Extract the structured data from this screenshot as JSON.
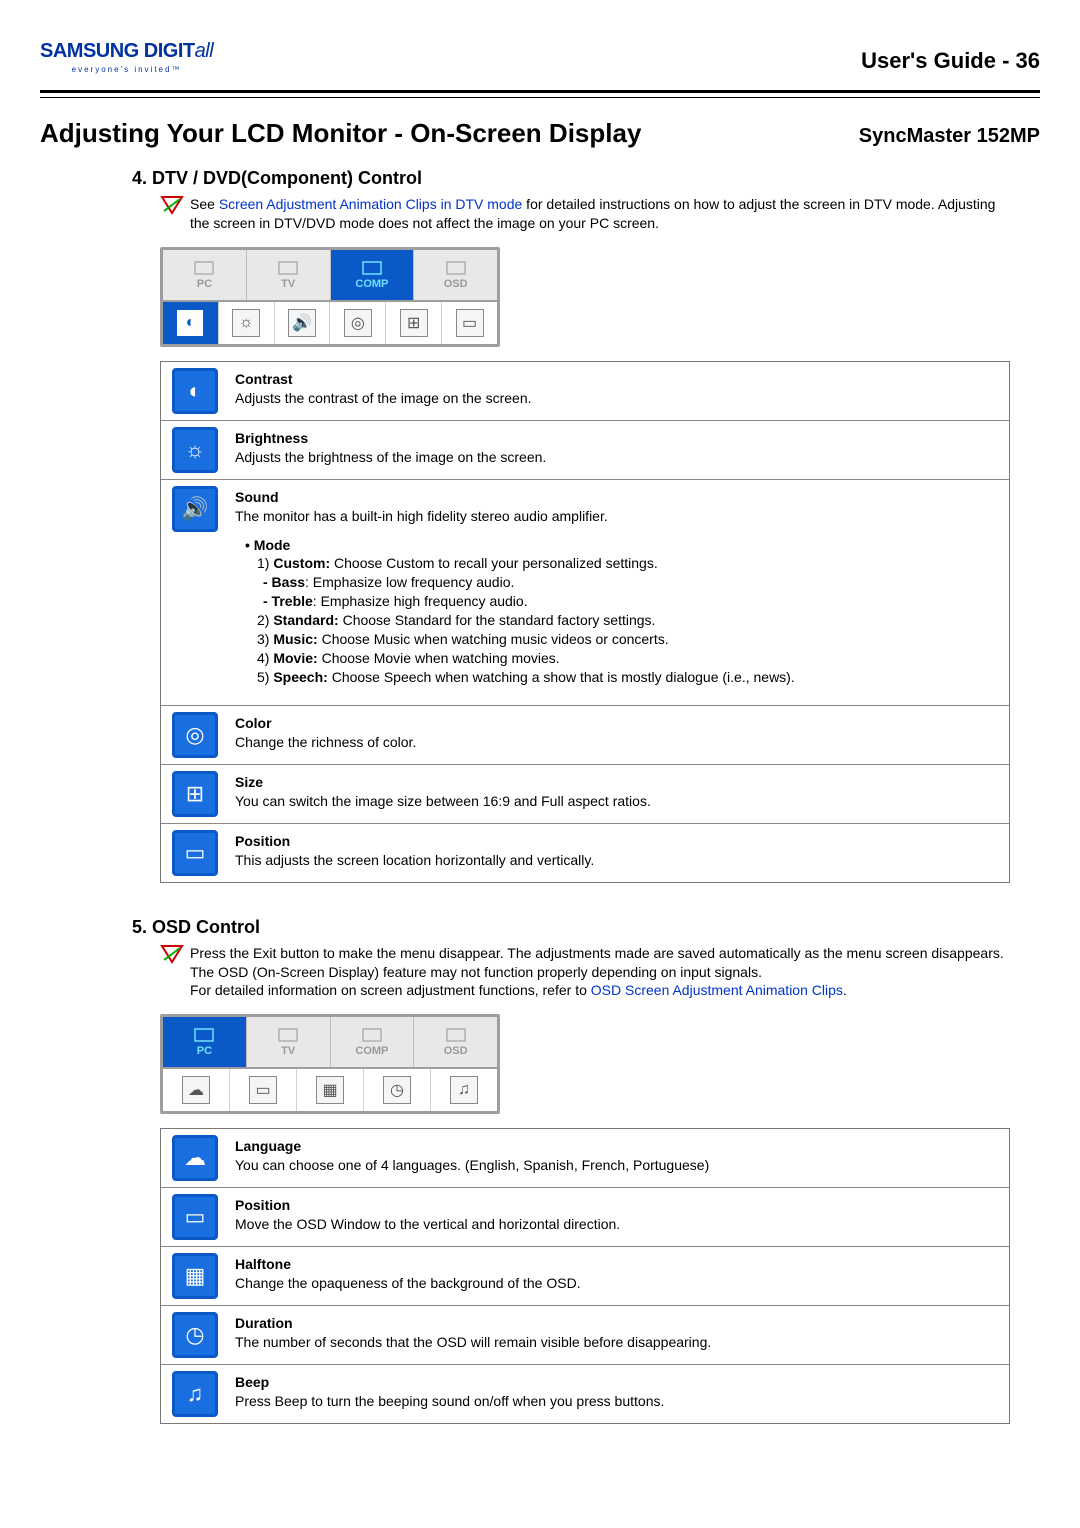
{
  "header": {
    "logo_main_1": "SAMSUNG ",
    "logo_main_2": "DIGIT",
    "logo_main_3": "all",
    "logo_tag": "everyone's invited™",
    "guide": "User's Guide - 36"
  },
  "main_heading": "Adjusting Your LCD Monitor - On-Screen Display",
  "model": "SyncMaster 152MP",
  "section4": {
    "heading": "4. DTV / DVD(Component) Control",
    "intro_pre": "See ",
    "intro_link": "Screen Adjustment Animation Clips in DTV mode",
    "intro_post": " for detailed instructions on how to adjust the screen in DTV mode. Adjusting the screen in DTV/DVD mode does not affect the image on your PC screen.",
    "tabs": [
      "PC",
      "TV",
      "COMP",
      "OSD"
    ],
    "active_tab_index": 2,
    "icon_row_count": 6,
    "selected_icon_index": 0,
    "rows": [
      {
        "icon": "◐",
        "name": "Contrast",
        "desc": "Adjusts the contrast of the image on the screen."
      },
      {
        "icon": "☼",
        "name": "Brightness",
        "desc": "Adjusts the brightness of the image on the screen."
      },
      {
        "icon": "🔊",
        "name": "Sound",
        "desc": "The monitor has a built-in high fidelity stereo audio amplifier.",
        "sub": {
          "mode_label": "• Mode",
          "items": [
            {
              "num": "1) ",
              "bold": "Custom:",
              "text": " Choose Custom to recall your personalized settings."
            },
            {
              "indent": true,
              "bold": "- Bass",
              "text": ": Emphasize low frequency audio."
            },
            {
              "indent": true,
              "bold": "- Treble",
              "text": ": Emphasize high frequency audio."
            },
            {
              "num": "2) ",
              "bold": "Standard:",
              "text": " Choose Standard for the standard factory settings."
            },
            {
              "num": "3) ",
              "bold": "Music:",
              "text": " Choose Music when watching music videos or concerts."
            },
            {
              "num": "4) ",
              "bold": "Movie:",
              "text": " Choose Movie when watching movies."
            },
            {
              "num": "5) ",
              "bold": "Speech:",
              "text": " Choose Speech when watching a show that is mostly dialogue (i.e., news)."
            }
          ]
        }
      },
      {
        "icon": "◎",
        "name": "Color",
        "desc": "Change the richness of color."
      },
      {
        "icon": "⊞",
        "name": "Size",
        "desc": "You can switch the image size between 16:9 and Full aspect ratios."
      },
      {
        "icon": "▭",
        "name": "Position",
        "desc": "This adjusts the screen location horizontally and vertically."
      }
    ]
  },
  "section5": {
    "heading": "5. OSD Control",
    "intro_pre": "Press the Exit button to make the menu disappear. The adjustments made are saved automatically as the menu screen disappears. The OSD (On-Screen Display) feature may not function properly depending on input signals.\nFor detailed information on screen adjustment functions, refer to ",
    "intro_link": "OSD Screen Adjustment Animation Clips",
    "intro_post": ".",
    "tabs": [
      "PC",
      "TV",
      "COMP",
      "OSD"
    ],
    "active_tab_index": 0,
    "icon_row_count": 5,
    "selected_icon_index": -1,
    "rows": [
      {
        "icon": "☁",
        "name": "Language",
        "desc": "You can choose one of 4 languages. (English, Spanish, French, Portuguese)"
      },
      {
        "icon": "▭",
        "name": "Position",
        "desc": "Move the OSD Window to the vertical and horizontal direction."
      },
      {
        "icon": "▦",
        "name": "Halftone",
        "desc": "Change the opaqueness of the background of the OSD."
      },
      {
        "icon": "◷",
        "name": "Duration",
        "desc": "The number of seconds that the OSD will remain visible before disappearing."
      },
      {
        "icon": "♫",
        "name": "Beep",
        "desc": "Press Beep to turn the beeping sound on/off when you press buttons."
      }
    ]
  }
}
